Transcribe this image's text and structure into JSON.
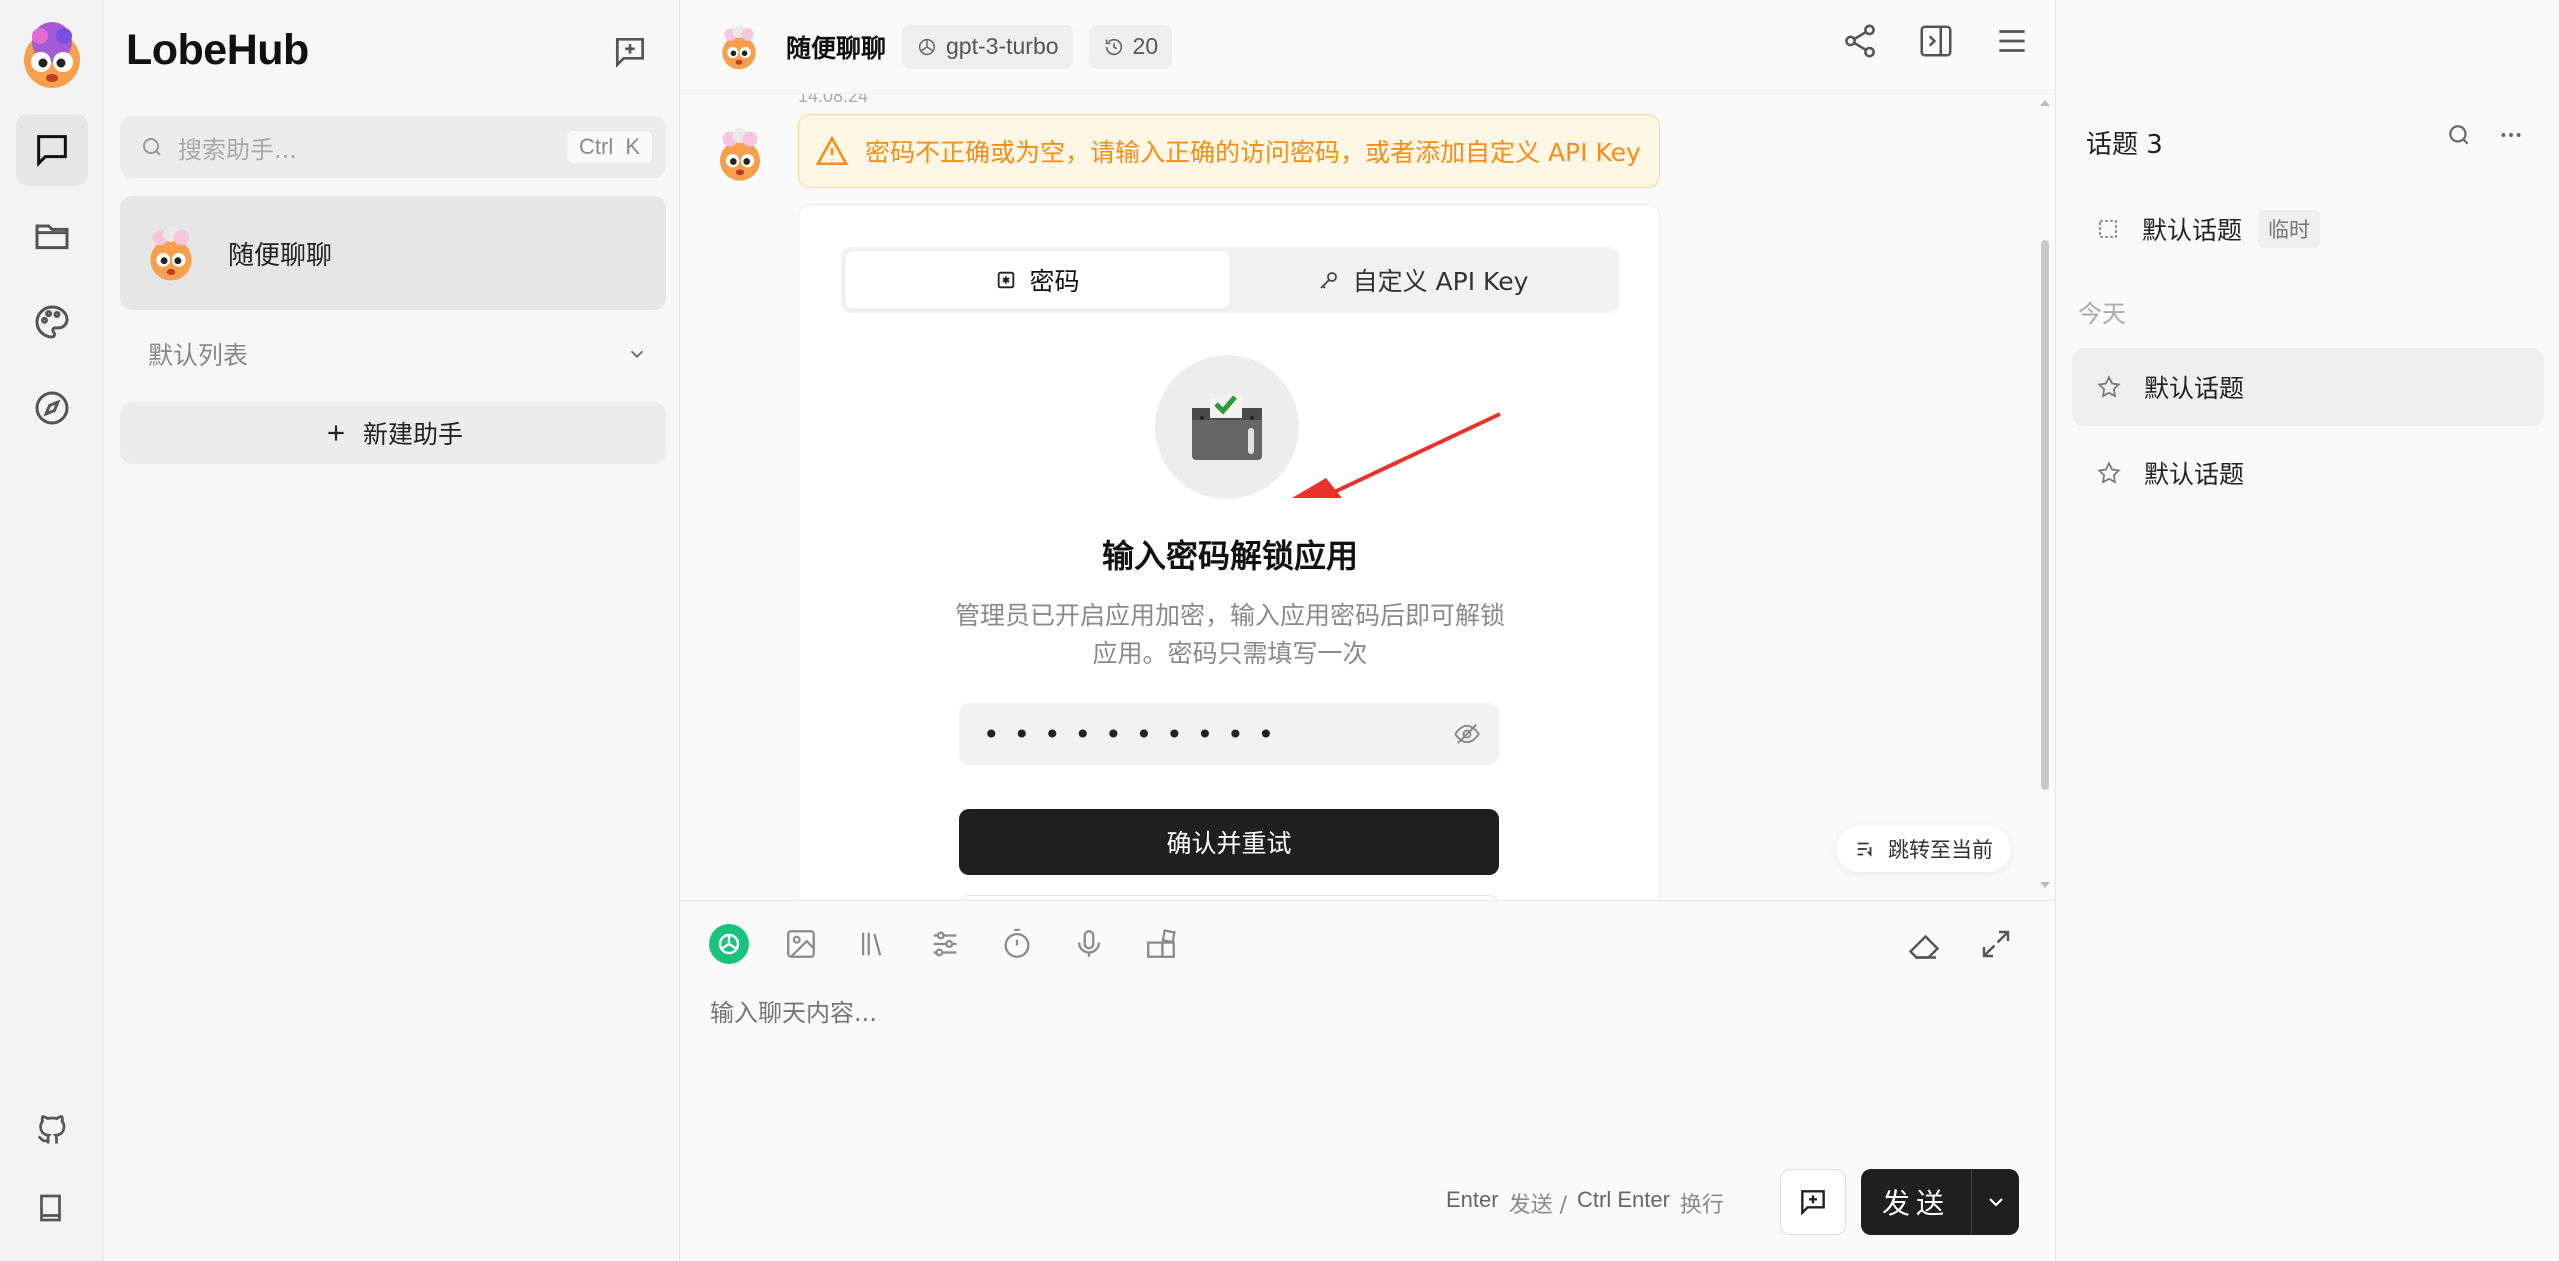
{
  "app": {
    "brand": "LobeHub"
  },
  "sidebar": {
    "search_placeholder": "搜索助手...",
    "search_shortcut": "Ctrl K",
    "sessions": [
      {
        "title": "随便聊聊"
      }
    ],
    "group_label": "默认列表",
    "new_assistant_label": "新建助手"
  },
  "header": {
    "title": "随便聊聊",
    "model": "gpt-3-turbo",
    "history_count": "20"
  },
  "chat": {
    "timestamp": "14:08:24",
    "alert_text": "密码不正确或为空，请输入正确的访问密码，或者添加自定义 API Key",
    "tabs": [
      {
        "label": "密码"
      },
      {
        "label": "自定义 API Key"
      }
    ],
    "lock_title": "输入密码解锁应用",
    "lock_desc": "管理员已开启应用加密，输入应用密码后即可解锁应用。密码只需填写一次",
    "password_value": "••••••••••",
    "confirm_label": "确认并重试",
    "jump_label": "跳转至当前"
  },
  "composer": {
    "placeholder": "输入聊天内容...",
    "hint_enter": "Enter",
    "hint_send": "发送 /",
    "hint_ctrl_enter": "Ctrl  Enter",
    "hint_newline": "换行",
    "send_label": "发送"
  },
  "topics": {
    "header": "话题 3",
    "today_label": "今天",
    "items": [
      {
        "title": "默认话题",
        "tag": "临时"
      },
      {
        "title": "默认话题"
      },
      {
        "title": "默认话题"
      }
    ]
  },
  "colors": {
    "accent": "#1f1f1f",
    "warning": "#fa8c16",
    "warning_bg": "#fff7e6",
    "openai_green": "#19c37d"
  }
}
